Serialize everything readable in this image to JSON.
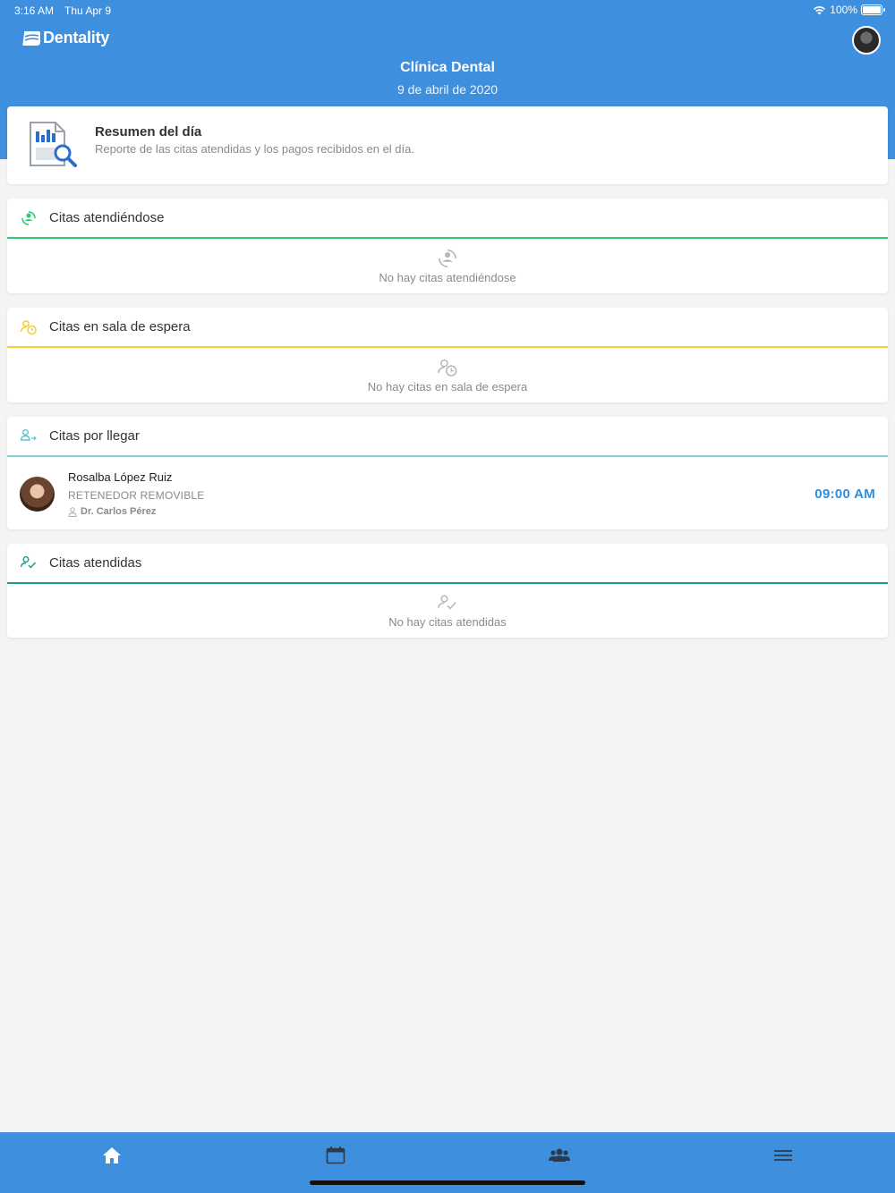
{
  "status_bar": {
    "time": "3:16 AM",
    "date": "Thu Apr 9",
    "battery": "100%"
  },
  "app": {
    "brand": "Dentality"
  },
  "header": {
    "title": "Clínica Dental",
    "date": "9 de abril de 2020"
  },
  "summary": {
    "title": "Resumen del día",
    "description": "Reporte de las citas atendidas y los pagos recibidos en el día."
  },
  "sections": [
    {
      "title": "Citas atendiéndose",
      "empty": "No hay citas atendiéndose",
      "color": "#2ecc71"
    },
    {
      "title": "Citas en sala de espera",
      "empty": "No hay citas en sala de espera",
      "color": "#f5cd2d"
    },
    {
      "title": "Citas por llegar",
      "color": "#7fd3d6"
    },
    {
      "title": "Citas atendidas",
      "empty": "No hay citas atendidas",
      "color": "#179e8a"
    }
  ],
  "appointment": {
    "patient": "Rosalba López Ruiz",
    "treatment": "RETENEDOR REMOVIBLE",
    "doctor": "Dr. Carlos Pérez",
    "time": "09:00 AM"
  },
  "tabs": [
    {
      "icon": "home-icon"
    },
    {
      "icon": "calendar-icon"
    },
    {
      "icon": "people-icon"
    },
    {
      "icon": "menu-icon"
    }
  ]
}
